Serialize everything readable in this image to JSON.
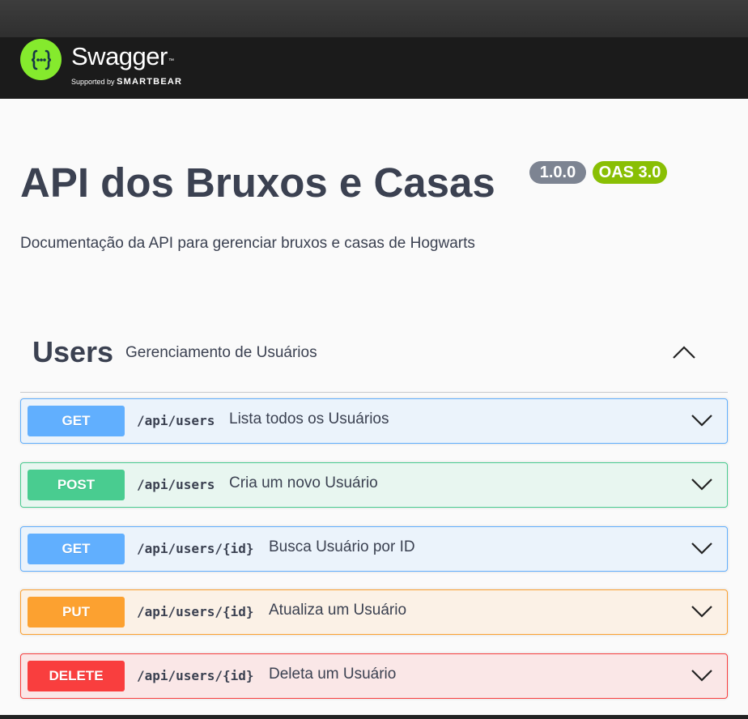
{
  "header": {
    "logo_icon": "swagger-braces-icon",
    "brand_name": "Swagger",
    "trademark": "™",
    "supported_by": "Supported by",
    "supporter": "SMARTBEAR",
    "colors": {
      "bar": "#1b1b1b",
      "logo": "#85ea2d"
    }
  },
  "info": {
    "title": "API dos Bruxos e Casas",
    "version": "1.0.0",
    "oas": "OAS 3.0",
    "description": "Documentação da API para gerenciar bruxos e casas de Hogwarts"
  },
  "tag": {
    "name": "Users",
    "description": "Gerenciamento de Usuários",
    "toggle_icon": "chevron-up-icon"
  },
  "operations": [
    {
      "method": "GET",
      "path": "/api/users",
      "summary": "Lista todos os Usuários",
      "color": "#61affe"
    },
    {
      "method": "POST",
      "path": "/api/users",
      "summary": "Cria um novo Usuário",
      "color": "#49cc90"
    },
    {
      "method": "GET",
      "path": "/api/users/{id}",
      "summary": "Busca Usuário por ID",
      "color": "#61affe"
    },
    {
      "method": "PUT",
      "path": "/api/users/{id}",
      "summary": "Atualiza um Usuário",
      "color": "#fca130"
    },
    {
      "method": "DELETE",
      "path": "/api/users/{id}",
      "summary": "Deleta um Usuário",
      "color": "#f93e3e"
    }
  ]
}
